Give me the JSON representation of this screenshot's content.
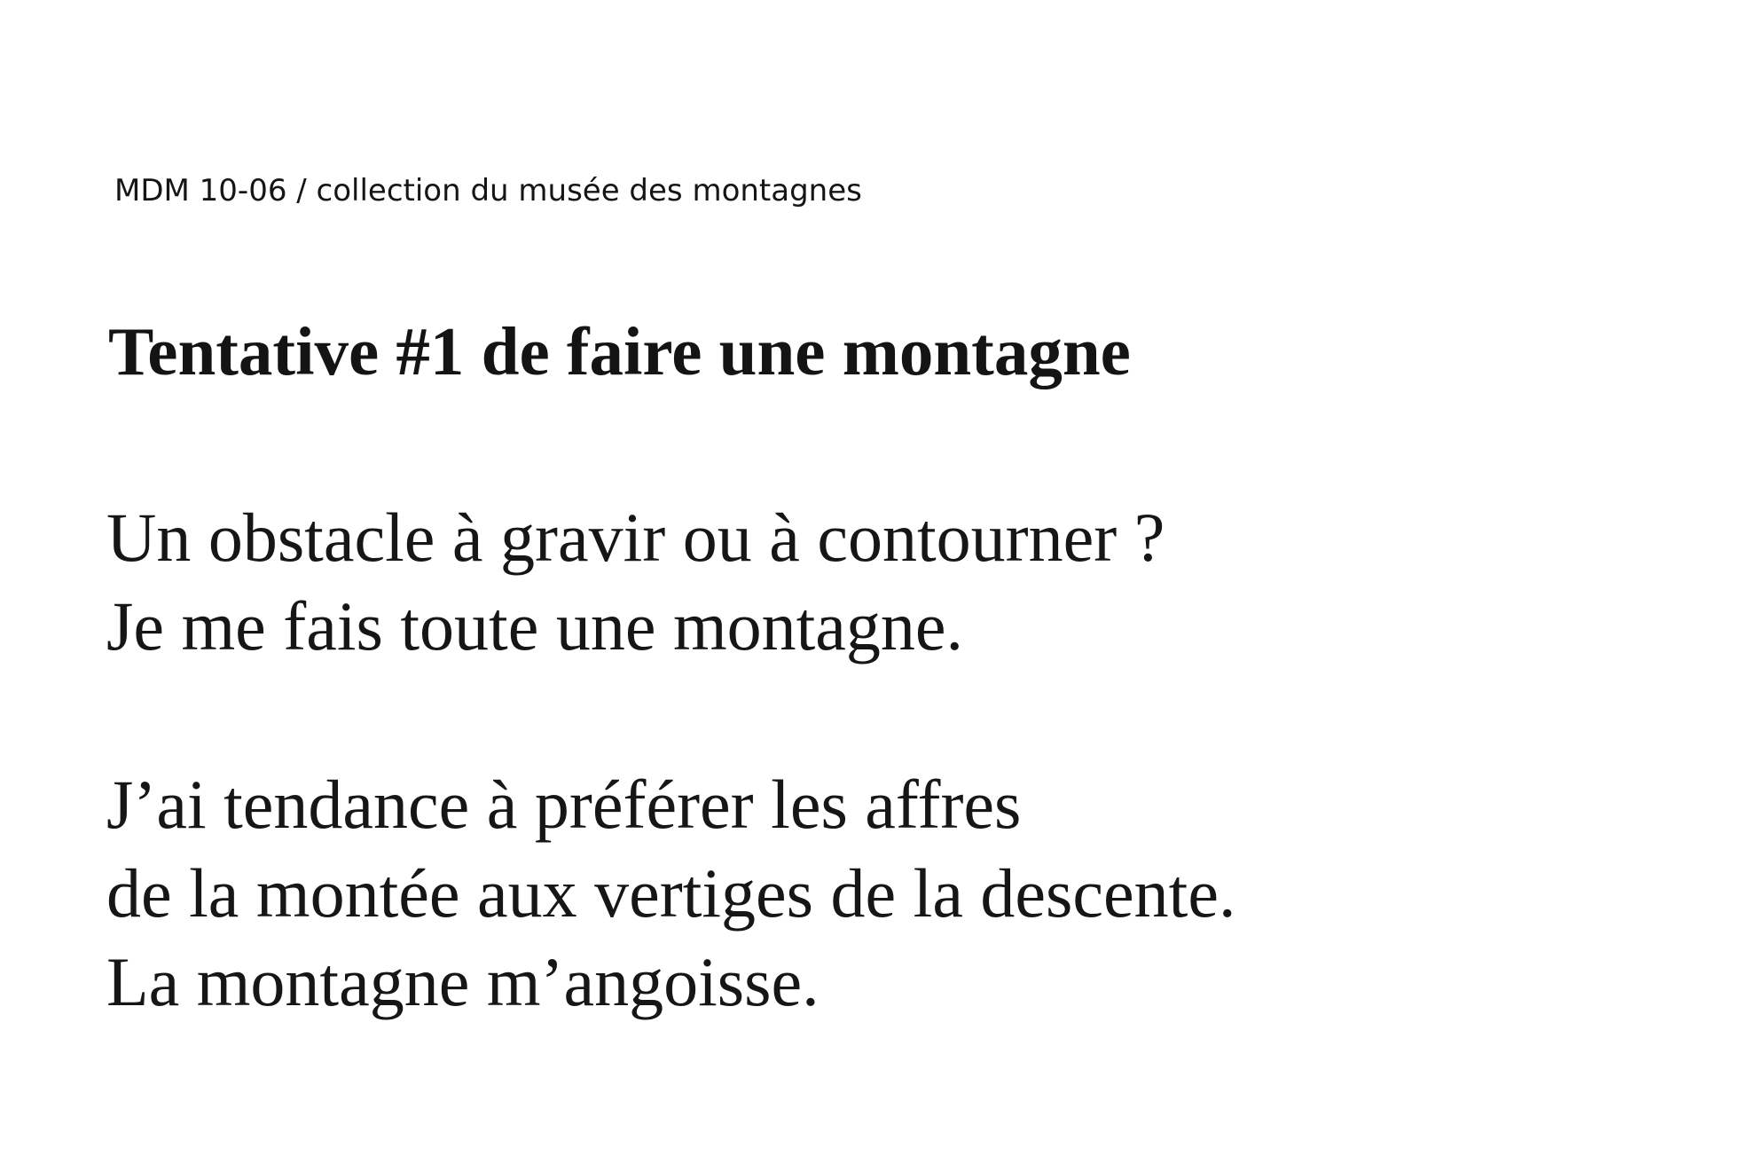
{
  "catalog_reference": "MDM 10-06 / collection du musée des montagnes",
  "title": "Tentative #1 de faire une montagne",
  "stanzas": [
    {
      "lines": [
        "Un obstacle à gravir ou à contourner ?",
        "Je me fais toute une montagne."
      ]
    },
    {
      "lines": [
        "J’ai tendance à préférer les affres",
        "de la montée aux vertiges de la descente.",
        "La montagne m’angoisse."
      ]
    }
  ]
}
